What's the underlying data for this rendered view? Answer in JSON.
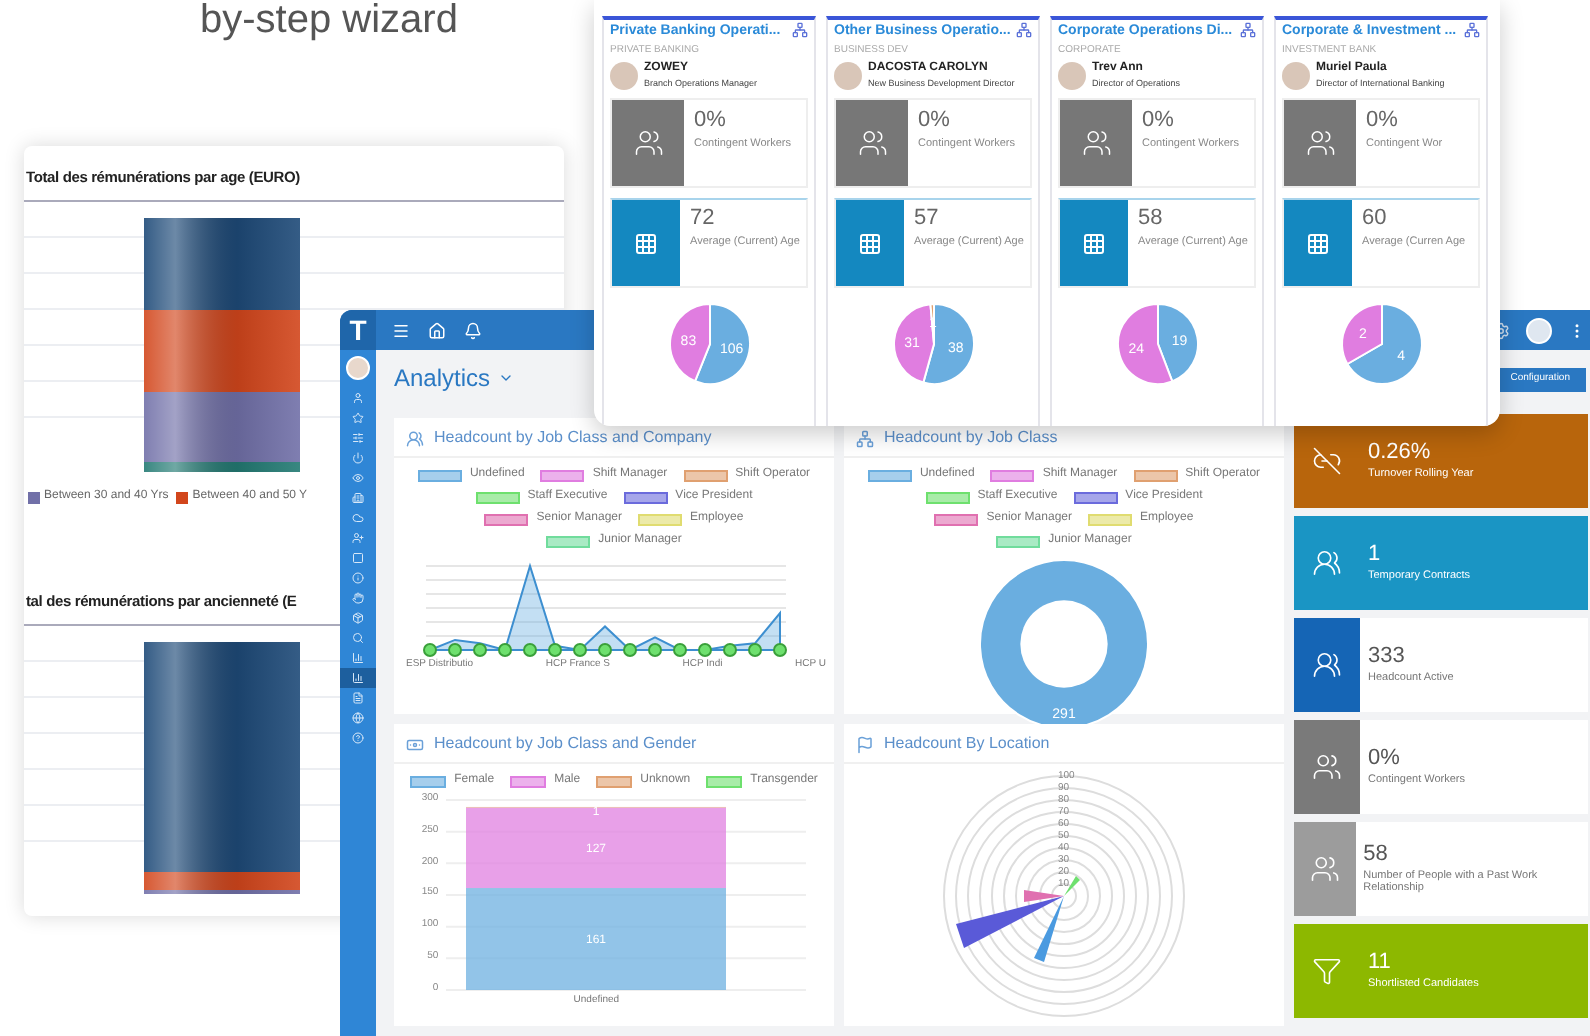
{
  "heading": "by-step wizard",
  "report": {
    "charts": [
      {
        "title": "Total des rémunérations par age (EURO)",
        "legend": [
          {
            "label": "Between 30 and 40 Yrs",
            "color": "#7170a8"
          },
          {
            "label": "Between 40 and 50 Y",
            "color": "#d2461c"
          }
        ]
      },
      {
        "title": "tal des rémunérations par ancienneté (E"
      }
    ]
  },
  "dashboard": {
    "logo": "T",
    "title": "Analytics",
    "config_button": "Configuration",
    "nav_items": [
      {
        "selected": false
      },
      {
        "selected": false
      },
      {
        "selected": false
      },
      {
        "selected": false
      },
      {
        "selected": false
      },
      {
        "selected": false
      },
      {
        "selected": false
      },
      {
        "selected": false
      },
      {
        "selected": false
      },
      {
        "selected": false
      },
      {
        "selected": false
      },
      {
        "selected": false
      },
      {
        "selected": false
      },
      {
        "selected": false
      },
      {
        "selected": true
      },
      {
        "selected": false
      },
      {
        "selected": false
      },
      {
        "selected": false
      }
    ],
    "panels": [
      {
        "kind": "line",
        "title": "Headcount by Job Class and Company",
        "legend": [
          {
            "label": "Undefined",
            "color": "#6aaee0"
          },
          {
            "label": "Shift Manager",
            "color": "#e07de0"
          },
          {
            "label": "Shift Operator",
            "color": "#e0a070"
          },
          {
            "label": "Staff Executive",
            "color": "#6ee06e"
          },
          {
            "label": "Vice President",
            "color": "#6b6bdc"
          },
          {
            "label": "Senior Manager",
            "color": "#e070b0"
          },
          {
            "label": "Employee",
            "color": "#e0dc70"
          },
          {
            "label": "Junior Manager",
            "color": "#70dc9c"
          }
        ],
        "x_labels": [
          "ESP Distributio",
          "HCP France S",
          "HCP Indi",
          "HCP U"
        ]
      },
      {
        "kind": "donut",
        "title": "Headcount by Job Class",
        "legend": [
          {
            "label": "Undefined",
            "color": "#6aaee0"
          },
          {
            "label": "Shift Manager",
            "color": "#e07de0"
          },
          {
            "label": "Shift Operator",
            "color": "#e0a070"
          },
          {
            "label": "Staff Executive",
            "color": "#6ee06e"
          },
          {
            "label": "Vice President",
            "color": "#6b6bdc"
          },
          {
            "label": "Senior Manager",
            "color": "#e070b0"
          },
          {
            "label": "Employee",
            "color": "#e0dc70"
          },
          {
            "label": "Junior Manager",
            "color": "#70dc9c"
          }
        ],
        "chart_data": {
          "type": "donut",
          "values": [
            291
          ],
          "data_labels": true
        }
      },
      {
        "kind": "bar",
        "title": "Headcount by Job Class and Gender",
        "chart_data": {
          "type": "bar",
          "stacked": true,
          "categories": [
            "Undefined"
          ],
          "series": [
            {
              "name": "Female",
              "color": "#6aaee0",
              "values": [
                161
              ]
            },
            {
              "name": "Male",
              "color": "#e07de0",
              "values": [
                127
              ]
            },
            {
              "name": "Unknown",
              "color": "#e0a070",
              "values": [
                1
              ]
            },
            {
              "name": "Transgender",
              "color": "#6ee06e",
              "values": [
                null
              ]
            }
          ],
          "ylim": [
            0,
            300
          ],
          "yticks": [
            0,
            50,
            100,
            150,
            200,
            250,
            300
          ],
          "grid": true,
          "data_labels": true
        }
      },
      {
        "kind": "polar",
        "title": "Headcount By Location",
        "rings": [
          "100",
          "90",
          "80",
          "70",
          "60",
          "50",
          "40",
          "30",
          "20",
          "10"
        ]
      }
    ],
    "kpis": [
      {
        "kind": "solid",
        "value": "0.26%",
        "label": "Turnover Rolling Year",
        "color": "#b8650c"
      },
      {
        "kind": "solid",
        "value": "1",
        "label": "Temporary Contracts",
        "color": "#1a95c4"
      },
      {
        "kind": "split",
        "value": "333",
        "label": "Headcount Active",
        "color": "#1565b5"
      },
      {
        "kind": "split",
        "value": "0%",
        "label": "Contingent Workers",
        "color": "#7a7a7a"
      },
      {
        "kind": "split",
        "value": "58",
        "label": "Number of People with a Past Work Relationship",
        "color": "#9c9c9c"
      },
      {
        "kind": "solid",
        "value": "11",
        "label": "Shortlisted Candidates",
        "color": "#8db800"
      }
    ]
  },
  "cards": [
    {
      "title": "Private Banking Operati...",
      "subtitle": "PRIVATE BANKING",
      "person": "ZOWEY",
      "role": "Branch Operations Manager",
      "contingent_value": "0%",
      "contingent_label": "Contingent Workers",
      "age_value": "72",
      "age_label": "Average (Current) Age",
      "chart_data": {
        "type": "pie",
        "values": [
          106,
          83
        ],
        "data_labels": true
      }
    },
    {
      "title": "Other Business Operatio...",
      "subtitle": "BUSINESS DEV",
      "person": "DACOSTA CAROLYN",
      "role": "New Business Development Director",
      "contingent_value": "0%",
      "contingent_label": "Contingent Workers",
      "age_value": "57",
      "age_label": "Average (Current) Age",
      "chart_data": {
        "type": "pie",
        "values": [
          38,
          31,
          1
        ],
        "data_labels": true
      }
    },
    {
      "title": "Corporate Operations Di...",
      "subtitle": "CORPORATE",
      "person": "Trev Ann",
      "role": "Director of Operations",
      "contingent_value": "0%",
      "contingent_label": "Contingent Workers",
      "age_value": "58",
      "age_label": "Average (Current) Age",
      "chart_data": {
        "type": "pie",
        "values": [
          19,
          24
        ],
        "data_labels": true
      }
    },
    {
      "title": "Corporate & Investment ...",
      "subtitle": "INVESTMENT BANK",
      "person": "Muriel Paula",
      "role": "Director of International Banking",
      "contingent_value": "0%",
      "contingent_label": "Contingent Wor",
      "age_value": "60",
      "age_label": "Average (Curren Age",
      "chart_data": {
        "type": "pie",
        "values": [
          4,
          2
        ],
        "data_labels": true
      }
    }
  ]
}
